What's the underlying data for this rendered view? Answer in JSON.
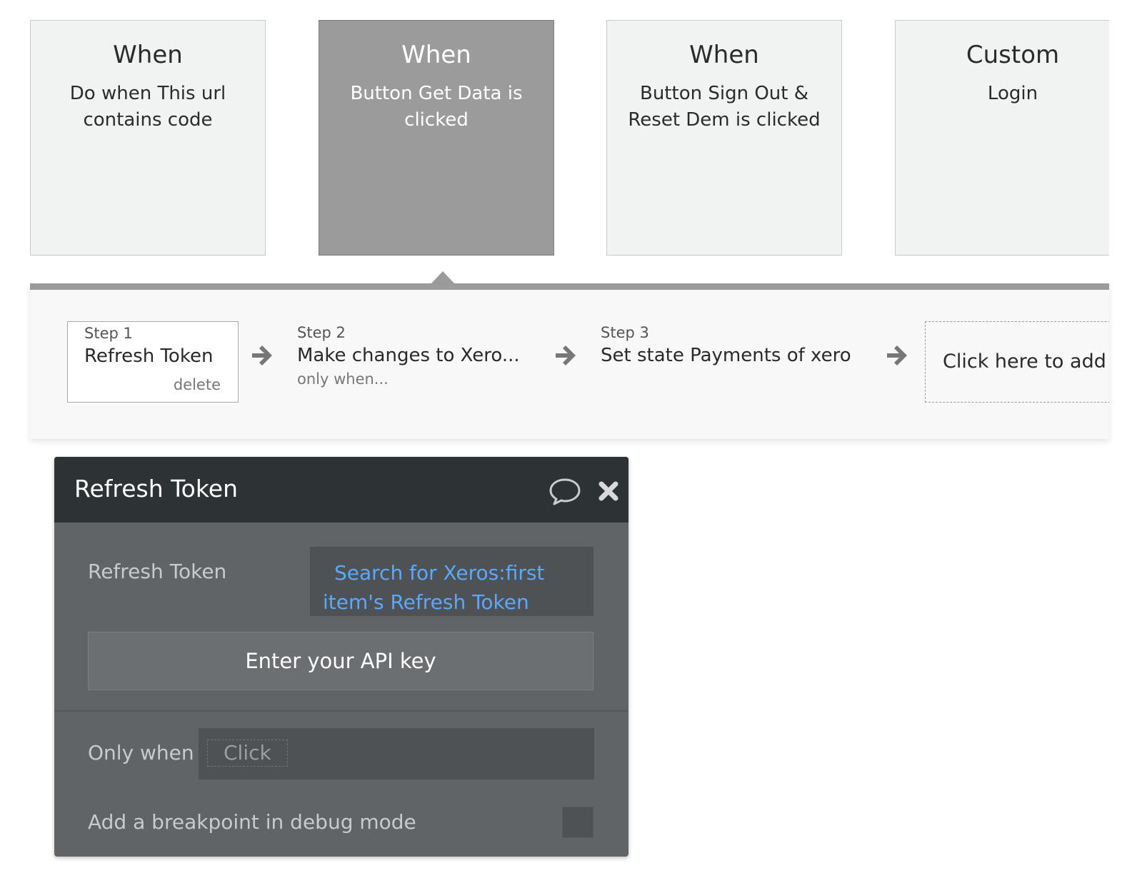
{
  "events": [
    {
      "type": "When",
      "description": "Do when This url contains code",
      "selected": false
    },
    {
      "type": "When",
      "description": "Button Get Data is clicked",
      "selected": true
    },
    {
      "type": "When",
      "description": "Button Sign Out & Reset Dem is clicked",
      "selected": false
    },
    {
      "type": "Custom",
      "description": "Login",
      "selected": false
    }
  ],
  "steps": [
    {
      "number": "Step 1",
      "title": "Refresh Token",
      "delete_label": "delete"
    },
    {
      "number": "Step 2",
      "title": "Make changes to Xero...",
      "condition_hint": "only when..."
    },
    {
      "number": "Step 3",
      "title": "Set state Payments of xero"
    }
  ],
  "add_step_label": "Click here to add",
  "editor": {
    "title": "Refresh Token",
    "comment_icon": "speech-bubble-icon",
    "close_icon": "close-icon",
    "field_label": "Refresh Token",
    "field_expression_line1": "Search for Xeros:first",
    "field_expression_line2": "item's Refresh Token",
    "api_key_button": "Enter your API key",
    "only_when_label": "Only when",
    "only_when_placeholder": "Click",
    "breakpoint_label": "Add a breakpoint in debug mode"
  },
  "colors": {
    "expression": "#5aa8ff",
    "editor_header": "#2d3234",
    "editor_body": "#606466",
    "selected_card": "#9b9b9b"
  }
}
